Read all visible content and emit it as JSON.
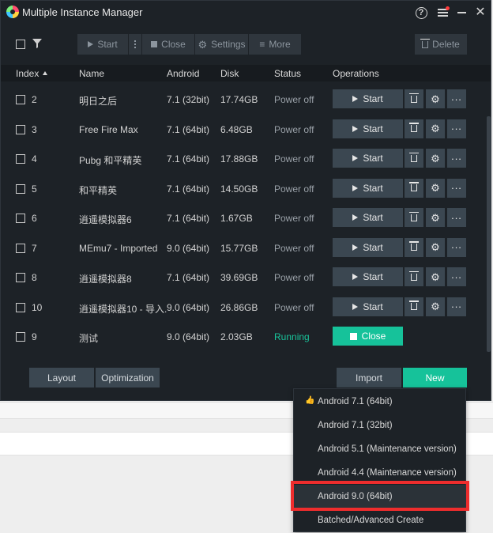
{
  "window": {
    "title": "Multiple Instance Manager"
  },
  "toolbar": {
    "start": "Start",
    "close": "Close",
    "settings": "Settings",
    "more": "More",
    "delete": "Delete"
  },
  "table": {
    "headers": {
      "index": "Index",
      "name": "Name",
      "android": "Android",
      "disk": "Disk",
      "status": "Status",
      "operations": "Operations"
    },
    "rows": [
      {
        "index": "2",
        "name": "明日之后",
        "android": "7.1 (32bit)",
        "disk": "17.74GB",
        "status": "Power off",
        "action": "Start"
      },
      {
        "index": "3",
        "name": "Free Fire Max",
        "android": "7.1 (64bit)",
        "disk": "6.48GB",
        "status": "Power off",
        "action": "Start"
      },
      {
        "index": "4",
        "name": "Pubg 和平精英",
        "android": "7.1 (64bit)",
        "disk": "17.88GB",
        "status": "Power off",
        "action": "Start"
      },
      {
        "index": "5",
        "name": "和平精英",
        "android": "7.1 (64bit)",
        "disk": "14.50GB",
        "status": "Power off",
        "action": "Start"
      },
      {
        "index": "6",
        "name": "逍遥模拟器6",
        "android": "7.1 (64bit)",
        "disk": "1.67GB",
        "status": "Power off",
        "action": "Start"
      },
      {
        "index": "7",
        "name": "MEmu7 - Imported",
        "android": "9.0 (64bit)",
        "disk": "15.77GB",
        "status": "Power off",
        "action": "Start"
      },
      {
        "index": "8",
        "name": "逍遥模拟器8",
        "android": "7.1 (64bit)",
        "disk": "39.69GB",
        "status": "Power off",
        "action": "Start"
      },
      {
        "index": "10",
        "name": "逍遥模拟器10 - 导入.",
        "android": "9.0 (64bit)",
        "disk": "26.86GB",
        "status": "Power off",
        "action": "Start"
      },
      {
        "index": "9",
        "name": "测试",
        "android": "9.0 (64bit)",
        "disk": "2.03GB",
        "status": "Running",
        "action": "Close"
      }
    ]
  },
  "bottom": {
    "layout": "Layout",
    "optimization": "Optimization",
    "import": "Import",
    "new": "New"
  },
  "new_menu": {
    "items": [
      "Android 7.1 (64bit)",
      "Android 7.1 (32bit)",
      "Android 5.1 (Maintenance version)",
      "Android 4.4 (Maintenance version)",
      "Android 9.0 (64bit)",
      "Batched/Advanced Create"
    ],
    "recommended_index": 0,
    "highlighted_index": 4
  },
  "colors": {
    "accent": "#16c29a",
    "highlight_border": "#ee2d2d",
    "recommended_icon": "#ffcc33"
  },
  "icons": {
    "help": "help-circle-icon",
    "menu": "menu-icon",
    "minimize": "minimize-icon",
    "close": "close-icon",
    "filter": "filter-icon",
    "play": "play-icon",
    "stop": "stop-icon",
    "gear": "gear-icon",
    "trash": "trash-icon",
    "more": "more-icon",
    "thumbs_up": "thumbs-up-icon"
  }
}
